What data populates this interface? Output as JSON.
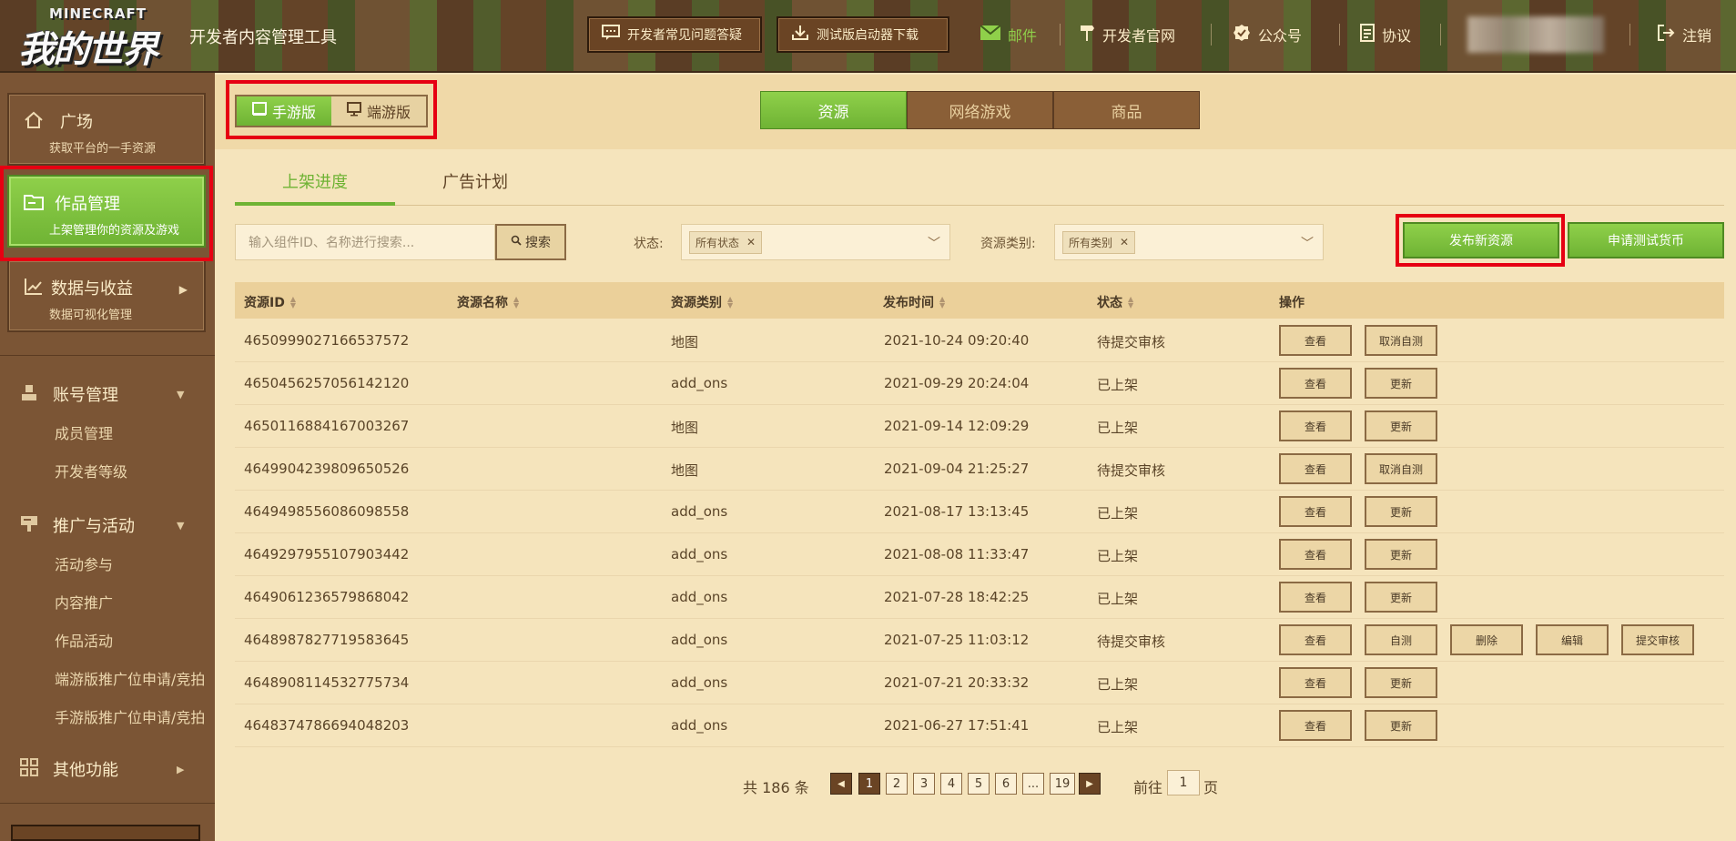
{
  "header": {
    "logo_top": "MINECRAFT",
    "logo_cn": "我的世界",
    "app_title": "开发者内容管理工具",
    "faq_label": "开发者常见问题答疑",
    "launcher_label": "测试版启动器下载",
    "mail_label": "邮件",
    "dev_site_label": "开发者官网",
    "wechat_label": "公众号",
    "agreement_label": "协议",
    "logout_label": "注销"
  },
  "sidebar": {
    "plaza_title": "广场",
    "plaza_sub": "获取平台的一手资源",
    "works_title": "作品管理",
    "works_sub": "上架管理你的资源及游戏",
    "data_title": "数据与收益",
    "data_sub": "数据可视化管理",
    "account_group": "账号管理",
    "account_items": [
      "成员管理",
      "开发者等级"
    ],
    "promo_group": "推广与活动",
    "promo_items": [
      "活动参与",
      "内容推广",
      "作品活动",
      "端游版推广位申请/竞拍",
      "手游版推广位申请/竞拍"
    ],
    "other_group": "其他功能"
  },
  "platform": {
    "mobile": "手游版",
    "pc": "端游版"
  },
  "main_tabs": [
    "资源",
    "网络游戏",
    "商品"
  ],
  "sub_tabs": [
    "上架进度",
    "广告计划"
  ],
  "search": {
    "placeholder": "输入组件ID、名称进行搜索...",
    "button": "搜索"
  },
  "filters": {
    "status_label": "状态:",
    "status_tag": "所有状态",
    "type_label": "资源类别:",
    "type_tag": "所有类别"
  },
  "actions": {
    "publish": "发布新资源",
    "apply_currency": "申请测试货币"
  },
  "table": {
    "headers": [
      "资源ID",
      "资源名称",
      "资源类别",
      "发布时间",
      "状态",
      "操作"
    ],
    "rows": [
      {
        "id": "4650999027166537572",
        "name": "",
        "type": "地图",
        "time": "2021-10-24 09:20:40",
        "status": "待提交审核",
        "ops": [
          "查看",
          "取消自测"
        ]
      },
      {
        "id": "4650456257056142120",
        "name": "",
        "type": "add_ons",
        "time": "2021-09-29 20:24:04",
        "status": "已上架",
        "ops": [
          "查看",
          "更新"
        ]
      },
      {
        "id": "4650116884167003267",
        "name": "",
        "type": "地图",
        "time": "2021-09-14 12:09:29",
        "status": "已上架",
        "ops": [
          "查看",
          "更新"
        ]
      },
      {
        "id": "4649904239809650526",
        "name": "",
        "type": "地图",
        "time": "2021-09-04 21:25:27",
        "status": "待提交审核",
        "ops": [
          "查看",
          "取消自测"
        ]
      },
      {
        "id": "4649498556086098558",
        "name": "",
        "type": "add_ons",
        "time": "2021-08-17 13:13:45",
        "status": "已上架",
        "ops": [
          "查看",
          "更新"
        ]
      },
      {
        "id": "4649297955107903442",
        "name": "",
        "type": "add_ons",
        "time": "2021-08-08 11:33:47",
        "status": "已上架",
        "ops": [
          "查看",
          "更新"
        ]
      },
      {
        "id": "4649061236579868042",
        "name": "",
        "type": "add_ons",
        "time": "2021-07-28 18:42:25",
        "status": "已上架",
        "ops": [
          "查看",
          "更新"
        ]
      },
      {
        "id": "4648987827719583645",
        "name": "",
        "type": "add_ons",
        "time": "2021-07-25 11:03:12",
        "status": "待提交审核",
        "ops": [
          "查看",
          "自测",
          "删除",
          "编辑",
          "提交审核"
        ]
      },
      {
        "id": "4648908114532775734",
        "name": "",
        "type": "add_ons",
        "time": "2021-07-21 20:33:32",
        "status": "已上架",
        "ops": [
          "查看",
          "更新"
        ]
      },
      {
        "id": "4648374786694048203",
        "name": "",
        "type": "add_ons",
        "time": "2021-06-27 17:51:41",
        "status": "已上架",
        "ops": [
          "查看",
          "更新"
        ]
      }
    ]
  },
  "pagination": {
    "total": "共 186 条",
    "pages": [
      "1",
      "2",
      "3",
      "4",
      "5",
      "6",
      "...",
      "19"
    ],
    "current": "1",
    "goto_prefix": "前往",
    "goto_value": "1",
    "goto_suffix": "页"
  },
  "colors": {
    "accent_green": "#6fb334",
    "brown": "#7b5535",
    "highlight_red": "#e60012"
  }
}
